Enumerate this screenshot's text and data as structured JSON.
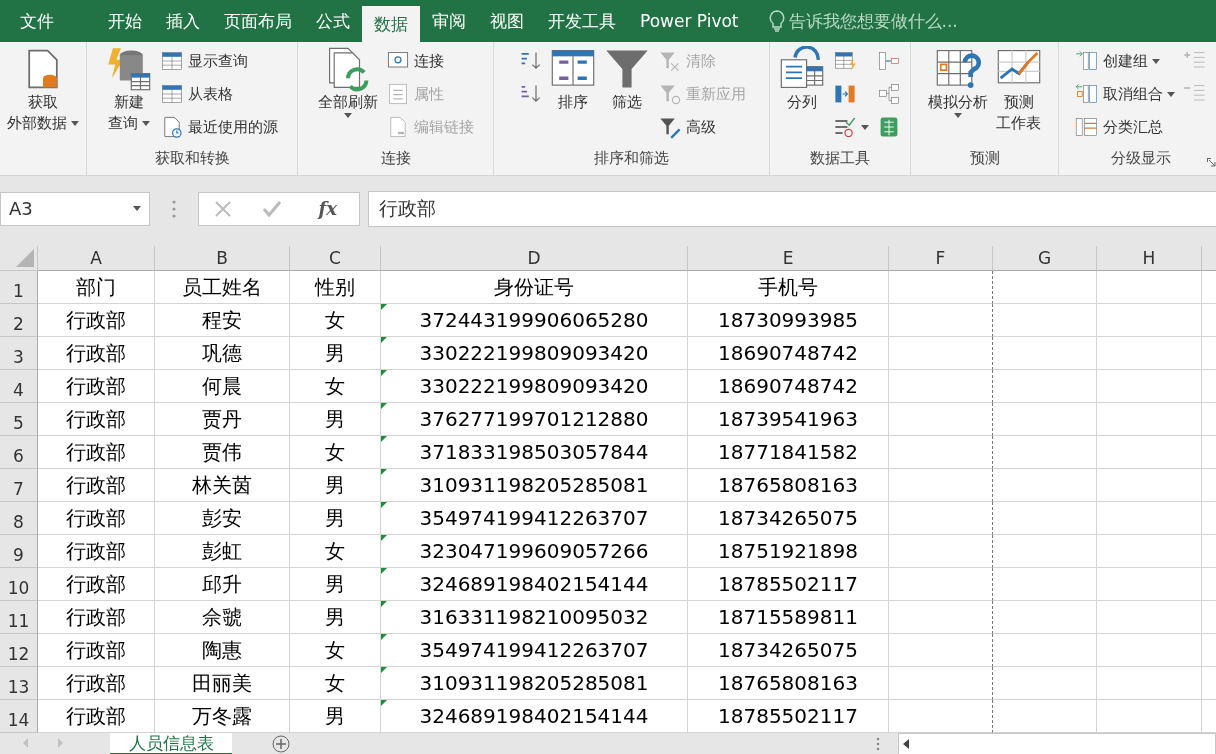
{
  "ribbon_tabs": [
    {
      "label": "文件",
      "selected": false
    },
    {
      "label": "开始",
      "selected": false
    },
    {
      "label": "插入",
      "selected": false
    },
    {
      "label": "页面布局",
      "selected": false
    },
    {
      "label": "公式",
      "selected": false
    },
    {
      "label": "数据",
      "selected": true
    },
    {
      "label": "审阅",
      "selected": false
    },
    {
      "label": "视图",
      "selected": false
    },
    {
      "label": "开发工具",
      "selected": false
    },
    {
      "label": "Power Pivot",
      "selected": false
    }
  ],
  "tell_me": {
    "placeholder": "告诉我您想要做什么..."
  },
  "ribbon_groups": [
    {
      "columns": [
        {
          "kind": "large",
          "lines": [
            "获取",
            "外部数据"
          ],
          "dropdown": true,
          "disabled": false
        }
      ]
    },
    {
      "label": "获取和转换",
      "columns": [
        {
          "kind": "large",
          "lines": [
            "新建",
            "查询"
          ],
          "dropdown": true,
          "disabled": false
        },
        {
          "kind": "stack",
          "items": [
            {
              "kind": "small",
              "label": "显示查询",
              "dropdown": false,
              "disabled": false
            },
            {
              "kind": "small",
              "label": "从表格",
              "dropdown": false,
              "disabled": false
            },
            {
              "kind": "small",
              "label": "最近使用的源",
              "dropdown": false,
              "disabled": false
            }
          ]
        }
      ]
    },
    {
      "label": "连接",
      "columns": [
        {
          "kind": "large",
          "lines": [
            "全部刷新"
          ],
          "dropdown": true,
          "disabled": false
        },
        {
          "kind": "stack",
          "items": [
            {
              "kind": "small",
              "label": "连接",
              "dropdown": false,
              "disabled": false
            },
            {
              "kind": "small",
              "label": "属性",
              "dropdown": false,
              "disabled": true
            },
            {
              "kind": "small",
              "label": "编辑链接",
              "dropdown": false,
              "disabled": true
            }
          ]
        }
      ]
    },
    {
      "label": "排序和筛选",
      "columns": [
        {
          "kind": "stack",
          "items": [
            {
              "kind": "icon",
              "dropdown": false,
              "disabled": false
            },
            {
              "kind": "icon",
              "dropdown": false,
              "disabled": false
            }
          ]
        },
        {
          "kind": "large",
          "lines": [
            "排序"
          ],
          "dropdown": false,
          "disabled": false
        },
        {
          "kind": "large",
          "lines": [
            "筛选"
          ],
          "dropdown": false,
          "disabled": false
        },
        {
          "kind": "stack",
          "items": [
            {
              "kind": "small",
              "label": "清除",
              "dropdown": false,
              "disabled": true
            },
            {
              "kind": "small",
              "label": "重新应用",
              "dropdown": false,
              "disabled": true
            },
            {
              "kind": "small",
              "label": "高级",
              "dropdown": false,
              "disabled": false
            }
          ]
        }
      ]
    },
    {
      "label": "数据工具",
      "columns": [
        {
          "kind": "large",
          "lines": [
            "分列"
          ],
          "dropdown": false,
          "disabled": false
        },
        {
          "kind": "stack",
          "items": [
            {
              "kind": "icon",
              "dropdown": false,
              "disabled": false
            },
            {
              "kind": "icon",
              "dropdown": false,
              "disabled": false
            },
            {
              "kind": "icon",
              "dropdown": true,
              "disabled": false
            }
          ]
        },
        {
          "kind": "stack",
          "items": [
            {
              "kind": "icon",
              "dropdown": false,
              "disabled": false
            },
            {
              "kind": "icon",
              "dropdown": false,
              "disabled": false
            },
            {
              "kind": "icon",
              "dropdown": false,
              "disabled": false
            }
          ]
        }
      ]
    },
    {
      "label": "预测",
      "columns": [
        {
          "kind": "large",
          "lines": [
            "模拟分析"
          ],
          "dropdown": true,
          "disabled": false
        },
        {
          "kind": "large",
          "lines": [
            "预测",
            "工作表"
          ],
          "dropdown": false,
          "disabled": false
        }
      ]
    },
    {
      "label": "分级显示",
      "launcher": true,
      "columns": [
        {
          "kind": "stack",
          "items": [
            {
              "kind": "small",
              "label": "创建组",
              "dropdown": true,
              "disabled": false
            },
            {
              "kind": "small",
              "label": "取消组合",
              "dropdown": true,
              "disabled": false
            },
            {
              "kind": "small",
              "label": "分类汇总",
              "dropdown": false,
              "disabled": false
            }
          ]
        },
        {
          "kind": "stack",
          "items": [
            {
              "kind": "icon",
              "dropdown": false,
              "disabled": true
            },
            {
              "kind": "icon",
              "dropdown": false,
              "disabled": true
            }
          ]
        }
      ]
    }
  ],
  "formula_bar": {
    "name_box": "A3",
    "function_label": "fx",
    "formula": "行政部"
  },
  "columns": [
    "A",
    "B",
    "C",
    "D",
    "E",
    "F",
    "G",
    "H"
  ],
  "rows": [
    {
      "number": "1",
      "cells": [
        "部门",
        "员工姓名",
        "性别",
        "身份证号",
        "手机号"
      ],
      "id_warning": false
    },
    {
      "number": "2",
      "cells": [
        "行政部",
        "程安",
        "女",
        "372443199906065280",
        "18730993985"
      ],
      "id_warning": true
    },
    {
      "number": "3",
      "cells": [
        "行政部",
        "巩德",
        "男",
        "330222199809093420",
        "18690748742"
      ],
      "id_warning": true
    },
    {
      "number": "4",
      "cells": [
        "行政部",
        "何晨",
        "女",
        "330222199809093420",
        "18690748742"
      ],
      "id_warning": true
    },
    {
      "number": "5",
      "cells": [
        "行政部",
        "贾丹",
        "男",
        "376277199701212880",
        "18739541963"
      ],
      "id_warning": true
    },
    {
      "number": "6",
      "cells": [
        "行政部",
        "贾伟",
        "女",
        "371833198503057844",
        "18771841582"
      ],
      "id_warning": true
    },
    {
      "number": "7",
      "cells": [
        "行政部",
        "林关茵",
        "男",
        "310931198205285081",
        "18765808163"
      ],
      "id_warning": true
    },
    {
      "number": "8",
      "cells": [
        "行政部",
        "彭安",
        "男",
        "354974199412263707",
        "18734265075"
      ],
      "id_warning": true
    },
    {
      "number": "9",
      "cells": [
        "行政部",
        "彭虹",
        "女",
        "323047199609057266",
        "18751921898"
      ],
      "id_warning": true
    },
    {
      "number": "10",
      "cells": [
        "行政部",
        "邱升",
        "男",
        "324689198402154144",
        "18785502117"
      ],
      "id_warning": true
    },
    {
      "number": "11",
      "cells": [
        "行政部",
        "佘虢",
        "男",
        "316331198210095032",
        "18715589811"
      ],
      "id_warning": true
    },
    {
      "number": "12",
      "cells": [
        "行政部",
        "陶惠",
        "女",
        "354974199412263707",
        "18734265075"
      ],
      "id_warning": true
    },
    {
      "number": "13",
      "cells": [
        "行政部",
        "田丽美",
        "女",
        "310931198205285081",
        "18765808163"
      ],
      "id_warning": true
    },
    {
      "number": "14",
      "cells": [
        "行政部",
        "万冬露",
        "男",
        "324689198402154144",
        "18785502117"
      ],
      "id_warning": true
    }
  ],
  "sheet_tabs": [
    {
      "label": "人员信息表",
      "selected": true
    }
  ]
}
